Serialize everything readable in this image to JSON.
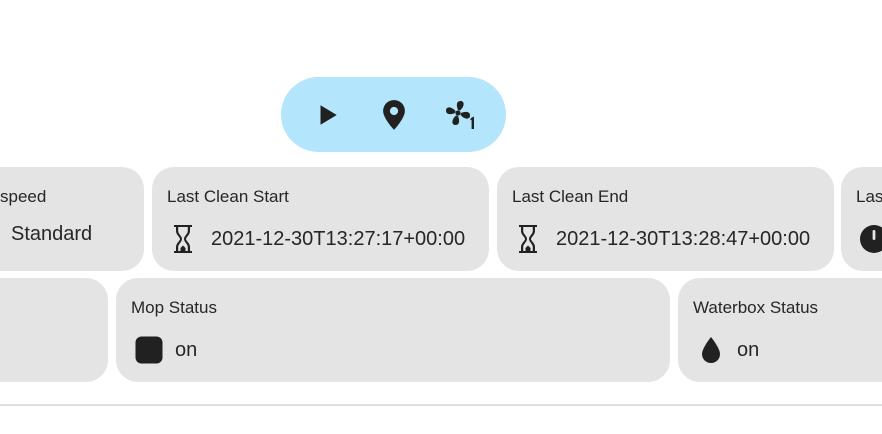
{
  "controls": {
    "start_icon": "play-icon",
    "locate_icon": "map-marker-icon",
    "fan_icon": "fan-speed-1-icon"
  },
  "cards": {
    "fan_speed": {
      "title": "speed",
      "value": "Standard"
    },
    "last_clean_start": {
      "title": "Last Clean Start",
      "value": "2021-12-30T13:27:17+00:00",
      "icon": "hourglass-icon"
    },
    "last_clean_end": {
      "title": "Last Clean End",
      "value": "2021-12-30T13:28:47+00:00",
      "icon": "hourglass-icon"
    },
    "last_partial": {
      "title": "Las",
      "icon": "clock-icon"
    },
    "mop_status": {
      "title": "Mop Status",
      "value": "on",
      "icon": "square-rounded-icon"
    },
    "waterbox_status": {
      "title": "Waterbox Status",
      "value": "on",
      "icon": "water-drop-icon"
    }
  },
  "colors": {
    "accent_bar": "#b3e5fc",
    "card_bg": "#e4e4e4",
    "icon": "#212121"
  }
}
